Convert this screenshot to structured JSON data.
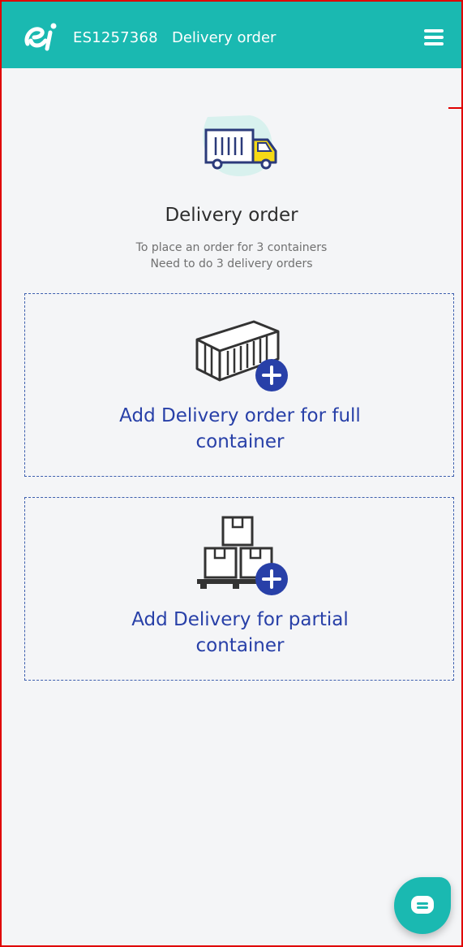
{
  "header": {
    "order_id": "ES1257368",
    "title": "Delivery order",
    "menu_icon": "hamburger-menu-icon",
    "logo_icon": "ei-logo"
  },
  "main": {
    "hero_icon": "delivery-truck-icon",
    "heading": "Delivery order",
    "hint_line1": "To place an order for 3 containers",
    "hint_line2": "Need to do 3 delivery orders",
    "options": [
      {
        "icon": "shipping-container-add-icon",
        "label_line1": "Add Delivery order for full",
        "label_line2": "container"
      },
      {
        "icon": "stacked-boxes-pallet-add-icon",
        "label_line1": "Add Delivery for partial",
        "label_line2": "container"
      }
    ]
  },
  "chat": {
    "icon": "chat-bubble-icon"
  },
  "colors": {
    "header_bg": "#1ab9b1",
    "accent_blue": "#2840a8",
    "page_bg": "#f4f5f7",
    "truck_yellow": "#f5d916",
    "border_red": "#e00000"
  }
}
